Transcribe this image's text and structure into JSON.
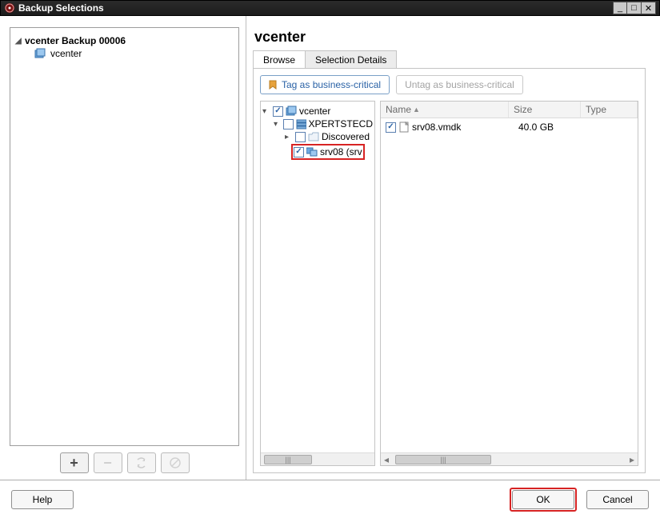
{
  "window": {
    "title": "Backup Selections"
  },
  "leftTree": {
    "root": "vcenter Backup 00006",
    "child": "vcenter"
  },
  "toolbar": {
    "add": "+",
    "remove": "−",
    "refresh": "↻",
    "cancel": "⊘"
  },
  "rightPanel": {
    "header": "vcenter",
    "tabs": {
      "browse": "Browse",
      "details": "Selection Details"
    },
    "actions": {
      "tag": "Tag as business-critical",
      "untag": "Untag as business-critical"
    },
    "rtree": {
      "root": "vcenter",
      "child1": "XPERTSTECD",
      "child2": "Discovered",
      "child3": "srv08 (srv"
    },
    "table": {
      "headers": {
        "name": "Name",
        "size": "Size",
        "type": "Type"
      },
      "row": {
        "name": "srv08.vmdk",
        "size": "40.0 GB",
        "type": ""
      }
    }
  },
  "footer": {
    "help": "Help",
    "ok": "OK",
    "cancel": "Cancel"
  }
}
